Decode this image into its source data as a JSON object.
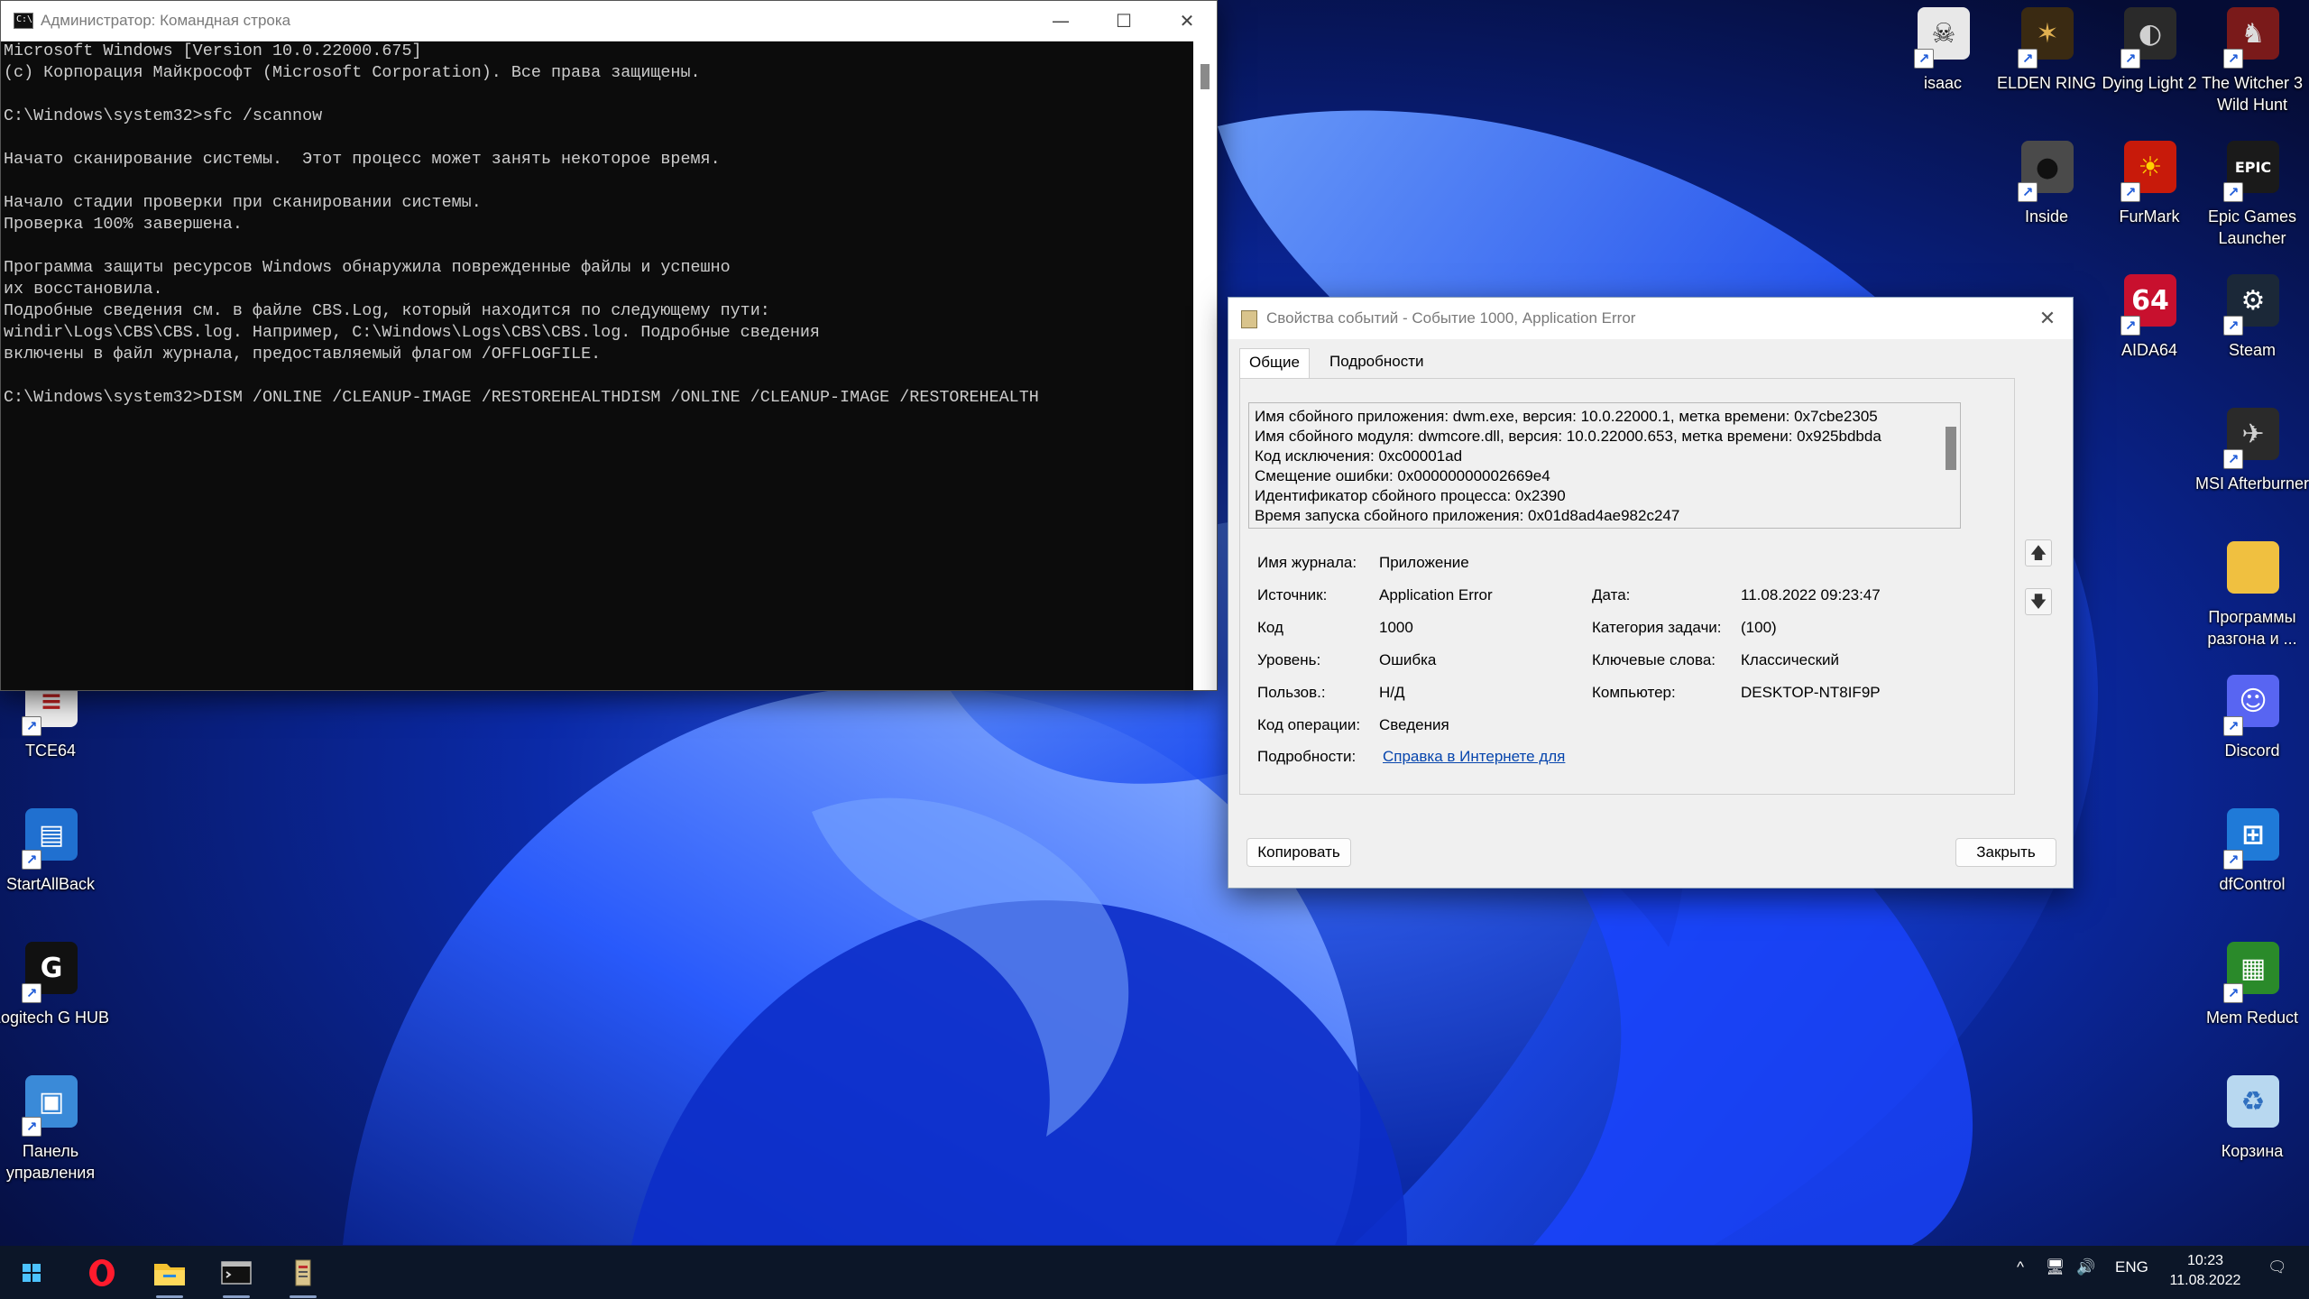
{
  "colors": {
    "console_text": "#cccccc",
    "console_bg": "#0c0c0c",
    "dialog_bg": "#f0f0f0",
    "link": "#0645ad",
    "taskbar_bg": "#0c1628",
    "wallpaper_blue": "#1f4bff"
  },
  "cmd": {
    "title": "Администратор: Командная строка",
    "lines": [
      "Microsoft Windows [Version 10.0.22000.675]",
      "(c) Корпорация Майкрософт (Microsoft Corporation). Все права защищены.",
      "",
      "C:\\Windows\\system32>sfc /scannow",
      "",
      "Начато сканирование системы.  Этот процесс может занять некоторое время.",
      "",
      "Начало стадии проверки при сканировании системы.",
      "Проверка 100% завершена.",
      "",
      "Программа защиты ресурсов Windows обнаружила поврежденные файлы и успешно",
      "их восстановила.",
      "Подробные сведения см. в файле CBS.Log, который находится по следующему пути:",
      "windir\\Logs\\CBS\\CBS.log. Например, C:\\Windows\\Logs\\CBS\\CBS.log. Подробные сведения",
      "включены в файл журнала, предоставляемый флагом /OFFLOGFILE.",
      "",
      "C:\\Windows\\system32>DISM /ONLINE /CLEANUP-IMAGE /RESTOREHEALTHDISM /ONLINE /CLEANUP-IMAGE /RESTOREHEALTH"
    ],
    "icon": "cmd-icon",
    "buttons": {
      "minimize": "—",
      "maximize": "☐",
      "close": "✕"
    }
  },
  "event": {
    "title": "Свойства событий - Событие 1000, Application Error",
    "tabs": [
      "Общие",
      "Подробности"
    ],
    "description": [
      "Имя сбойного приложения: dwm.exe, версия: 10.0.22000.1, метка времени: 0x7cbe2305",
      "Имя сбойного модуля: dwmcore.dll, версия: 10.0.22000.653, метка времени: 0x925bdbda",
      "Код исключения: 0xc00001ad",
      "Смещение ошибки: 0x00000000002669e4",
      "Идентификатор сбойного процесса: 0x2390",
      "Время запуска сбойного приложения: 0x01d8ad4ae982c247"
    ],
    "fields_left": [
      {
        "label": "Имя журнала:",
        "value": "Приложение"
      },
      {
        "label": "Источник:",
        "value": "Application Error"
      },
      {
        "label": "Код",
        "value": "1000"
      },
      {
        "label": "Уровень:",
        "value": "Ошибка"
      },
      {
        "label": "Пользов.:",
        "value": "Н/Д"
      },
      {
        "label": "Код операции:",
        "value": "Сведения"
      },
      {
        "label": "Подробности:",
        "value": "Справка в Интернете для "
      }
    ],
    "fields_right": [
      {
        "label": "Дата:",
        "value": "11.08.2022 09:23:47"
      },
      {
        "label": "Категория задачи:",
        "value": "(100)"
      },
      {
        "label": "Ключевые слова:",
        "value": "Классический"
      },
      {
        "label": "Компьютер:",
        "value": "DESKTOP-NT8IF9P"
      }
    ],
    "copy_button": "Копировать",
    "close_button": "Закрыть",
    "close_glyph": "✕",
    "up_glyph": "🡅",
    "down_glyph": "🡇"
  },
  "desktop_icons": [
    {
      "label": "isaac",
      "icon": "isaac-icon",
      "color": "#e8e8e8",
      "glyph": "☠",
      "fg": "#222"
    },
    {
      "label": "ELDEN RING",
      "icon": "elden-ring-icon",
      "color": "#3a2a12",
      "glyph": "✶",
      "fg": "#e0b050"
    },
    {
      "label": "Dying Light 2",
      "icon": "dying-light-icon",
      "color": "#2a2a2a",
      "glyph": "◐",
      "fg": "#d0d0d0"
    },
    {
      "label": "The Witcher 3 Wild Hunt",
      "icon": "witcher-icon",
      "color": "#7a1a1a",
      "glyph": "♞",
      "fg": "#ddd"
    },
    {
      "label": "Inside",
      "icon": "inside-icon",
      "color": "#4a4a4a",
      "glyph": "●",
      "fg": "#111"
    },
    {
      "label": "FurMark",
      "icon": "furmark-icon",
      "color": "#c81a0a",
      "glyph": "☀",
      "fg": "#ffd000"
    },
    {
      "label": "Epic Games Launcher",
      "icon": "epic-games-icon",
      "color": "#1a1a1a",
      "glyph": "EPIC",
      "fg": "#fff"
    },
    {
      "label": "AIDA64",
      "icon": "aida64-icon",
      "color": "#c8102e",
      "glyph": "64",
      "fg": "#fff"
    },
    {
      "label": "Steam",
      "icon": "steam-icon",
      "color": "#1b2838",
      "glyph": "⚙",
      "fg": "#fff"
    },
    {
      "label": "MSI Afterburner",
      "icon": "msi-afterburner-icon",
      "color": "#2a2a2a",
      "glyph": "✈",
      "fg": "#d0d0d0"
    },
    {
      "label": "Программы разгона и ...",
      "icon": "folder-icon",
      "color": "#f0c040",
      "glyph": "",
      "fg": "#fff"
    },
    {
      "label": "Discord",
      "icon": "discord-icon",
      "color": "#5865f2",
      "glyph": "☺",
      "fg": "#fff"
    },
    {
      "label": "dfControl",
      "icon": "dfcontrol-icon",
      "color": "#1f7ad8",
      "glyph": "⊞",
      "fg": "#fff"
    },
    {
      "label": "Mem Reduct",
      "icon": "mem-reduct-icon",
      "color": "#2a8a2a",
      "glyph": "▦",
      "fg": "#fff"
    },
    {
      "label": "Корзина",
      "icon": "recycle-bin-icon",
      "color": "#b8d8f0",
      "glyph": "♻",
      "fg": "#3070c0"
    },
    {
      "label": "TCE64",
      "icon": "tce64-icon",
      "color": "#f0f0f0",
      "glyph": "≡",
      "fg": "#c02020"
    },
    {
      "label": "StartAllBack",
      "icon": "startallback-icon",
      "color": "#2070d0",
      "glyph": "▤",
      "fg": "#fff"
    },
    {
      "label": "Logitech G HUB",
      "icon": "logitech-icon",
      "color": "#111111",
      "glyph": "G",
      "fg": "#fff"
    },
    {
      "label": "Панель управления",
      "icon": "control-panel-icon",
      "color": "#3a8ad8",
      "glyph": "▣",
      "fg": "#fff"
    }
  ],
  "taskbar": {
    "items": [
      {
        "name": "start-button",
        "icon": "windows-logo-icon"
      },
      {
        "name": "opera-button",
        "icon": "opera-icon"
      },
      {
        "name": "explorer-button",
        "icon": "file-explorer-icon"
      },
      {
        "name": "cmd-button",
        "icon": "cmd-icon"
      },
      {
        "name": "event-viewer-button",
        "icon": "event-viewer-icon"
      }
    ],
    "tray_chevron": "^",
    "language": "ENG",
    "time": "10:23",
    "date": "11.08.2022",
    "volume_glyph": "🔊",
    "network_glyph": "🖥",
    "notification_glyph": "🗨"
  }
}
